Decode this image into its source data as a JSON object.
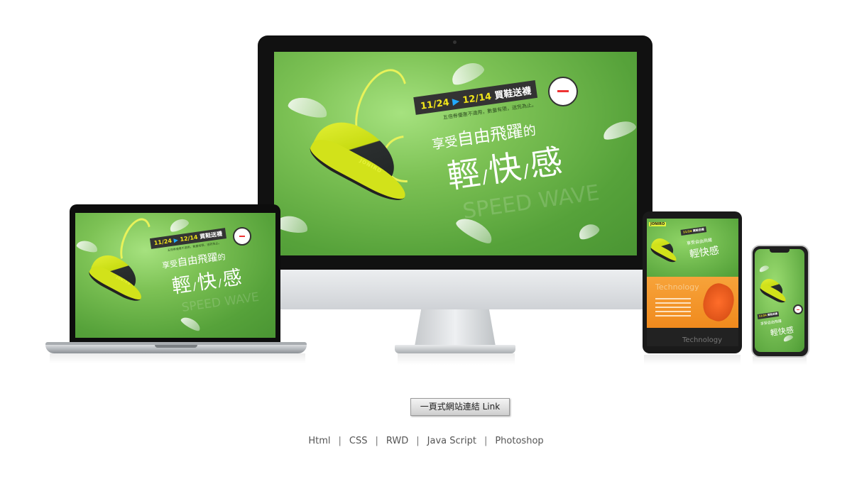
{
  "banner": {
    "promo_dates": "11/24",
    "promo_end": "12/14",
    "promo_gift": "買鞋送襪",
    "promo_note": "五倍券優惠不適用，數量有限，送完為止。",
    "tagline_pre": "享受",
    "tagline_big": "自由飛躍",
    "tagline_post": "的",
    "headline_1": "輕",
    "headline_2": "快",
    "headline_3": "感",
    "watermark": "SPEED WAVE",
    "brand": "JONIRO"
  },
  "tablet": {
    "brand": "JONIRO",
    "section_title": "Technology",
    "section_title_2": "Technology"
  },
  "link_button": {
    "label": "一頁式網站連結  Link"
  },
  "skills": [
    "Html",
    "CSS",
    "RWD",
    "Java Script",
    "Photoshop"
  ],
  "colors": {
    "banner_green": "#56a23a",
    "accent_yellow": "#e6f23a",
    "tablet_orange": "#f08a1d"
  }
}
